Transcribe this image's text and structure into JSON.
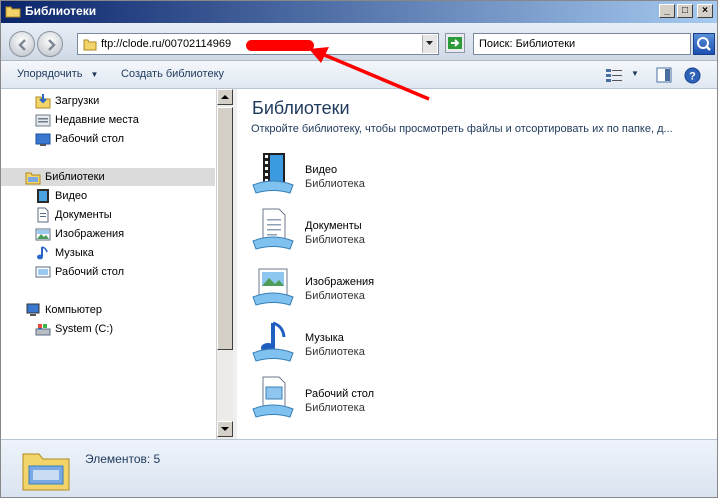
{
  "window": {
    "title": "Библиотеки"
  },
  "nav": {
    "address": "ftp://clode.ru/00702114969",
    "search_placeholder": "Поиск: Библиотеки"
  },
  "toolbar": {
    "organize_label": "Упорядочить",
    "create_library_label": "Создать библиотеку"
  },
  "sidebar": {
    "items": [
      {
        "label": "Загрузки",
        "icon": "downloads-icon"
      },
      {
        "label": "Недавние места",
        "icon": "recent-places-icon"
      },
      {
        "label": "Рабочий стол",
        "icon": "desktop-icon"
      },
      {
        "label": "Библиотеки",
        "icon": "libraries-icon",
        "selected": true
      },
      {
        "label": "Видео",
        "icon": "video-icon"
      },
      {
        "label": "Документы",
        "icon": "documents-icon"
      },
      {
        "label": "Изображения",
        "icon": "pictures-icon"
      },
      {
        "label": "Музыка",
        "icon": "music-icon"
      },
      {
        "label": "Рабочий стол",
        "icon": "desktop-icon"
      },
      {
        "label": "Компьютер",
        "icon": "computer-icon"
      },
      {
        "label": "System (C:)",
        "icon": "drive-icon"
      }
    ]
  },
  "main": {
    "title": "Библиотеки",
    "description": "Откройте библиотеку, чтобы просмотреть файлы и отсортировать их по папке, д...",
    "libraries": [
      {
        "name": "Видео",
        "kind": "Библиотека",
        "icon": "video-library-icon"
      },
      {
        "name": "Документы",
        "kind": "Библиотека",
        "icon": "documents-library-icon"
      },
      {
        "name": "Изображения",
        "kind": "Библиотека",
        "icon": "pictures-library-icon"
      },
      {
        "name": "Музыка",
        "kind": "Библиотека",
        "icon": "music-library-icon"
      },
      {
        "name": "Рабочий стол",
        "kind": "Библиотека",
        "icon": "desktop-library-icon"
      }
    ]
  },
  "status": {
    "count_text": "Элементов: 5"
  },
  "colors": {
    "annotation": "#ff0000",
    "accent": "#1e395b",
    "selection": "#dbdbdb"
  }
}
